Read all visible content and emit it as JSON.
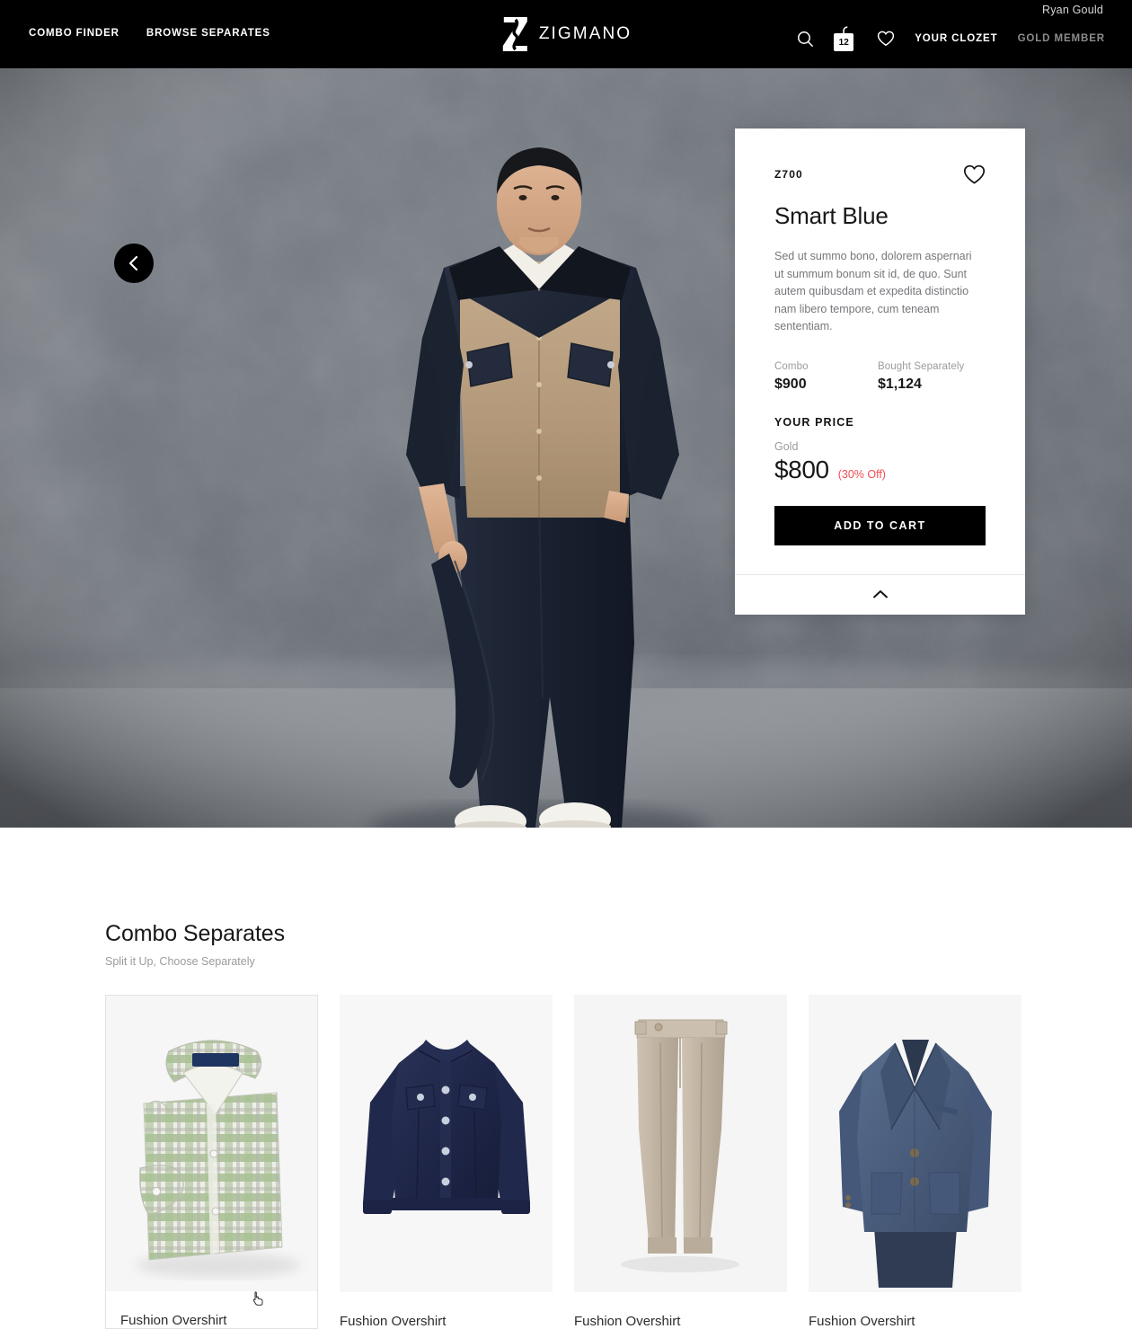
{
  "header": {
    "nav_left": [
      {
        "label": "COMBO FINDER",
        "name": "nav-combo-finder"
      },
      {
        "label": "BROWSE SEPARATES",
        "name": "nav-browse-separates"
      }
    ],
    "logo_text": "ZIGMANO",
    "logo_mark": "z-monogram-icon",
    "search_icon": "search-icon",
    "bag_icon": "shopping-bag-icon",
    "bag_count": "12",
    "wishlist_icon": "heart-icon",
    "clozet_label": "YOUR CLOZET",
    "member_label": "GOLD MEMBER",
    "user_name": "Ryan Gould"
  },
  "hero": {
    "prev_icon": "chevron-left-icon",
    "prev_label": "Previous look"
  },
  "product": {
    "sku": "Z700",
    "wishlist_icon": "heart-outline-icon",
    "title": "Smart Blue",
    "description": "Sed ut summo bono, dolorem aspernari ut summum bonum sit id, de quo. Sunt autem quibusdam et expedita distinctio nam libero tempore, cum teneam sententiam.",
    "combo_label": "Combo",
    "combo_price": "$900",
    "separate_label": "Bought Separately",
    "separate_price": "$1,124",
    "your_price_heading": "YOUR PRICE",
    "tier_label": "Gold",
    "final_price": "$800",
    "discount": "(30% Off)",
    "cta_label": "ADD TO CART",
    "collapse_icon": "chevron-up-icon"
  },
  "separates": {
    "title": "Combo Separates",
    "subtitle": "Split it Up, Choose Separately",
    "items": [
      {
        "label": "Fushion Overshirt",
        "thumb": "green-plaid-folded-shirt",
        "hovered": true
      },
      {
        "label": "Fushion Overshirt",
        "thumb": "navy-trucker-jacket",
        "hovered": false
      },
      {
        "label": "Fushion Overshirt",
        "thumb": "beige-tailored-trousers",
        "hovered": false
      },
      {
        "label": "Fushion Overshirt",
        "thumb": "blue-suit-jacket",
        "hovered": false
      }
    ]
  },
  "cursor": {
    "type": "pointer-hand-cursor"
  },
  "colors": {
    "header_bg": "#000000",
    "accent_discount": "#f24b52",
    "muted_text": "#9a9b9f",
    "member_text": "#8c8c8c",
    "cta_bg": "#000000"
  }
}
